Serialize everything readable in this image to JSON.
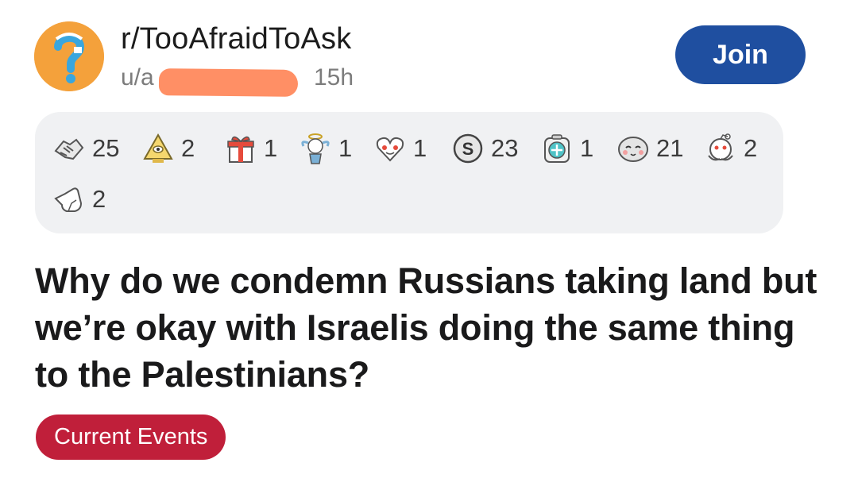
{
  "post": {
    "subreddit": "r/TooAfraidToAsk",
    "user_prefix": "u/a",
    "age": "15h",
    "join_label": "Join",
    "title": "Why do we condemn Russians taking land but we’re okay with Israelis doing the same thing to the Palestinians?",
    "flair": "Current Events",
    "flair_color": "#c01f3a",
    "join_color": "#1f4fa0",
    "redaction_color": "#ff8a5f"
  },
  "awards": [
    {
      "icon": "handshake-award-icon",
      "count": "25"
    },
    {
      "icon": "illuminati-award-icon",
      "count": "2"
    },
    {
      "icon": "gift-award-icon",
      "count": "1"
    },
    {
      "icon": "angel-award-icon",
      "count": "1"
    },
    {
      "icon": "wholesome-heart-award-icon",
      "count": "1"
    },
    {
      "icon": "silver-award-icon",
      "count": "23"
    },
    {
      "icon": "helpful-award-icon",
      "count": "1"
    },
    {
      "icon": "blushing-seal-award-icon",
      "count": "21"
    },
    {
      "icon": "snoo-facepalm-award-icon",
      "count": "2"
    },
    {
      "icon": "point-award-icon",
      "count": "2"
    }
  ]
}
